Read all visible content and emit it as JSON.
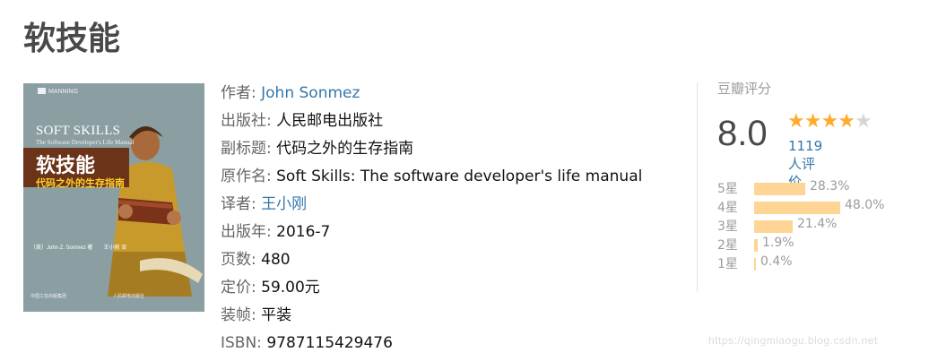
{
  "page": {
    "title": "软技能"
  },
  "cover": {
    "publisher_mark": "MANNING",
    "title_en": "SOFT SKILLS",
    "subtitle_en": "The Software Developer's Life Manual",
    "title_cn": "软技能",
    "subtitle_cn": "代码之外的生存指南",
    "authors": "〔美〕John Z. Sonmez 著　　王小刚 译",
    "footer_left": "中国工信出版集团",
    "footer_right": "人民邮电出版社"
  },
  "info": {
    "author_label": "作者:",
    "author": "John Sonmez",
    "publisher_label": "出版社:",
    "publisher": "人民邮电出版社",
    "subtitle_label": "副标题:",
    "subtitle": "代码之外的生存指南",
    "original_label": "原作名:",
    "original": "Soft Skills: The software developer's life manual",
    "translator_label": "译者:",
    "translator": "王小刚",
    "pubyear_label": "出版年:",
    "pubyear": "2016-7",
    "pages_label": "页数:",
    "pages": "480",
    "price_label": "定价:",
    "price": "59.00元",
    "binding_label": "装帧:",
    "binding": "平装",
    "isbn_label": "ISBN:",
    "isbn": "9787115429476"
  },
  "rating": {
    "header": "豆瓣评分",
    "score": "8.0",
    "stars": 4,
    "votes": "1119人评价",
    "accent": "#ffac2d",
    "bar_color": "#ffd596",
    "distribution": [
      {
        "label": "5星",
        "pct": "28.3%",
        "value": 28.3
      },
      {
        "label": "4星",
        "pct": "48.0%",
        "value": 48.0
      },
      {
        "label": "3星",
        "pct": "21.4%",
        "value": 21.4
      },
      {
        "label": "2星",
        "pct": "1.9%",
        "value": 1.9
      },
      {
        "label": "1星",
        "pct": "0.4%",
        "value": 0.4
      }
    ]
  },
  "watermark": "https://qingmiaogu.blog.csdn.net"
}
